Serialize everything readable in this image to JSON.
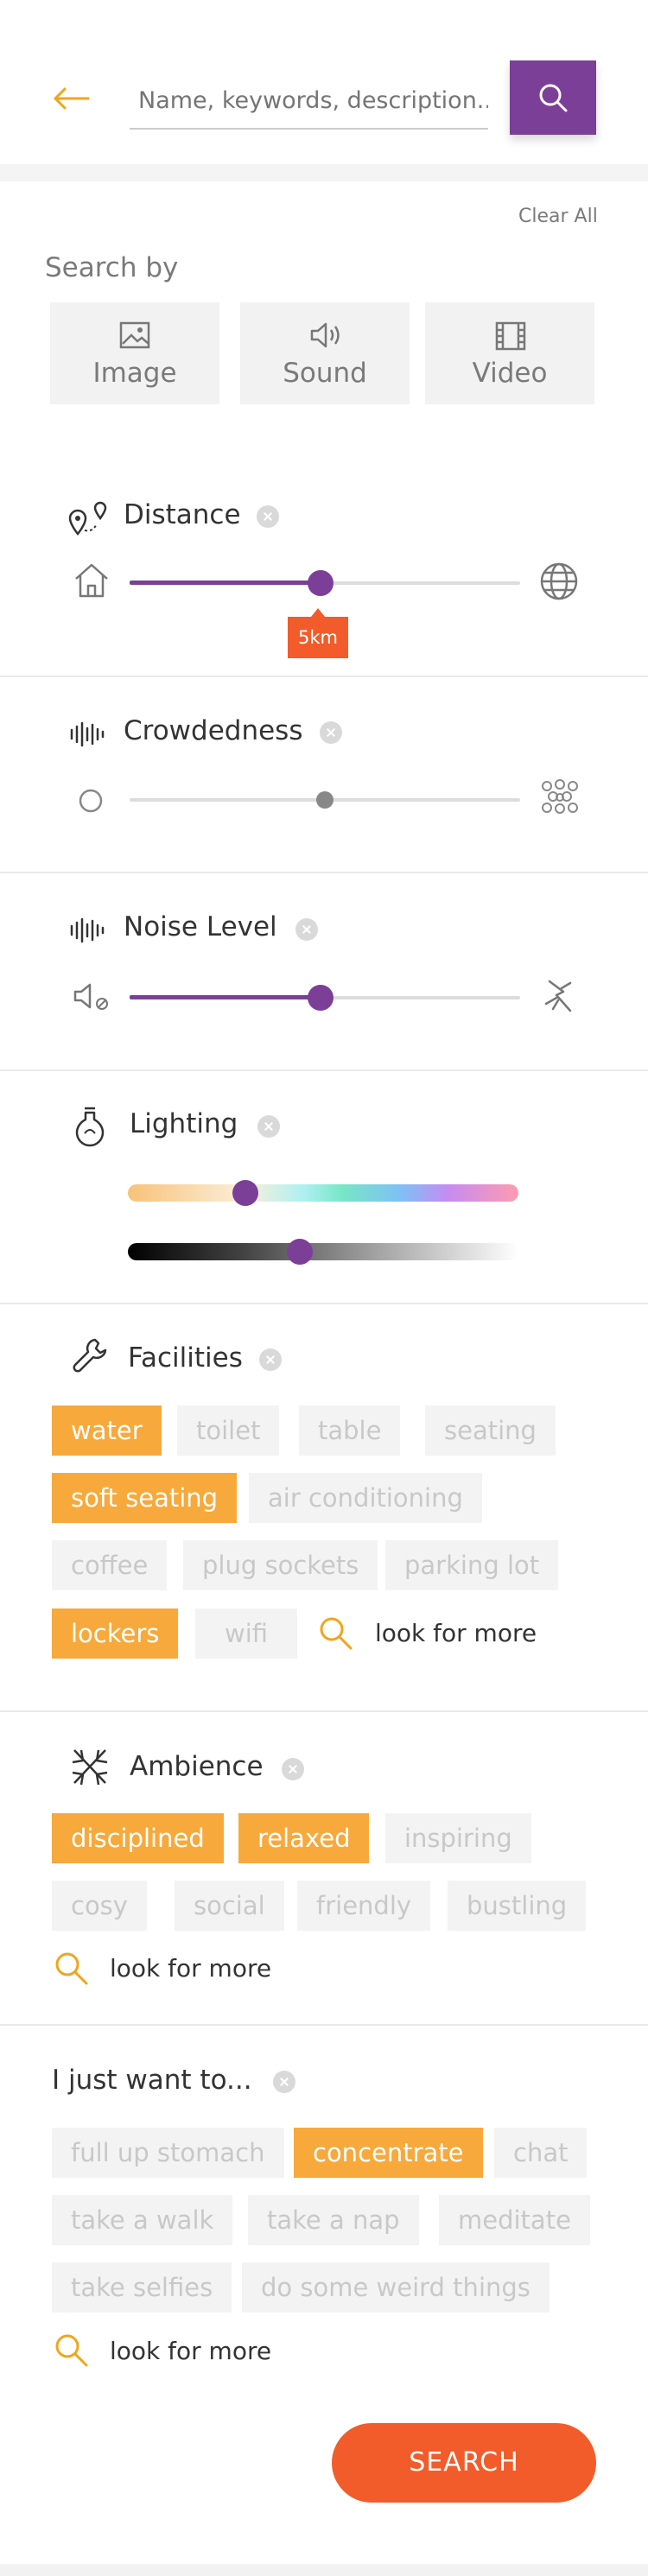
{
  "header": {
    "search_placeholder": "Name, keywords, description..."
  },
  "clear_all": "Clear All",
  "search_by": {
    "label": "Search by",
    "tiles": [
      "Image",
      "Sound",
      "Video"
    ]
  },
  "distance": {
    "title": "Distance",
    "value_label": "5km",
    "level": 0.49
  },
  "crowdedness": {
    "title": "Crowdedness",
    "level": 0.5
  },
  "noise": {
    "title": "Noise Level",
    "level": 0.49
  },
  "lighting": {
    "title": "Lighting",
    "color_level": 0.3,
    "brightness_level": 0.44
  },
  "facilities": {
    "title": "Facilities",
    "chips": [
      "water",
      "toilet",
      "table",
      "seating",
      "soft seating",
      "air conditioning",
      "coffee",
      "plug sockets",
      "parking lot",
      "lockers",
      "wifi"
    ],
    "selected": [
      "water",
      "soft seating",
      "lockers"
    ],
    "more": "look for more"
  },
  "ambience": {
    "title": "Ambience",
    "chips": [
      "disciplined",
      "relaxed",
      "inspiring",
      "cosy",
      "social",
      "friendly",
      "bustling"
    ],
    "selected": [
      "disciplined",
      "relaxed"
    ],
    "more": "look for more"
  },
  "intent": {
    "title": "I just want to...",
    "chips": [
      "full up stomach",
      "concentrate",
      "chat",
      "take a walk",
      "take a nap",
      "meditate",
      "take selfies",
      "do some weird things"
    ],
    "selected": [
      "concentrate"
    ],
    "more": "look for more"
  },
  "search_button": "SEARCH",
  "colors": {
    "accent": "#7b3f98",
    "chip_on": "#f7a93c",
    "cta": "#f25c2a",
    "back": "#f0a51d"
  }
}
